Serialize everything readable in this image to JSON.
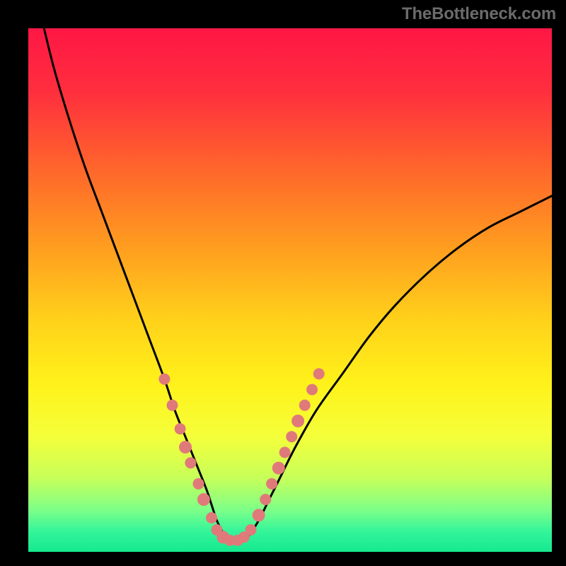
{
  "watermark": "TheBottleneck.com",
  "colors": {
    "frame": "#000000",
    "gradient_stops": [
      {
        "offset": 0.0,
        "color": "#ff1745"
      },
      {
        "offset": 0.12,
        "color": "#ff2e3e"
      },
      {
        "offset": 0.28,
        "color": "#ff6a2a"
      },
      {
        "offset": 0.42,
        "color": "#ff9e1f"
      },
      {
        "offset": 0.56,
        "color": "#ffd21a"
      },
      {
        "offset": 0.68,
        "color": "#fff21a"
      },
      {
        "offset": 0.78,
        "color": "#f4ff3a"
      },
      {
        "offset": 0.86,
        "color": "#c6ff5a"
      },
      {
        "offset": 0.92,
        "color": "#7dff88"
      },
      {
        "offset": 0.96,
        "color": "#35f59a"
      },
      {
        "offset": 1.0,
        "color": "#15e98f"
      }
    ],
    "curve": "#000000",
    "marker_fill": "#e07a7a",
    "marker_stroke": "#c96060"
  },
  "chart_data": {
    "type": "line",
    "title": "",
    "xlabel": "",
    "ylabel": "",
    "xlim": [
      0,
      100
    ],
    "ylim": [
      0,
      100
    ],
    "grid": false,
    "legend": false,
    "series": [
      {
        "name": "bottleneck-curve",
        "x": [
          3,
          5,
          8,
          11,
          14,
          17,
          20,
          23,
          26,
          28,
          30,
          32,
          34,
          35,
          36,
          37,
          38,
          39,
          40,
          42,
          44,
          46,
          48,
          51,
          55,
          60,
          65,
          70,
          76,
          82,
          88,
          94,
          100
        ],
        "y": [
          100,
          92,
          82,
          73,
          65,
          57,
          49,
          41,
          33,
          27,
          22,
          17,
          12,
          9,
          6,
          4,
          2.5,
          2,
          2,
          3,
          6,
          10,
          14,
          20,
          27,
          34,
          41,
          47,
          53,
          58,
          62,
          65,
          68
        ]
      }
    ],
    "markers": [
      {
        "x": 26,
        "y": 33,
        "r": 8
      },
      {
        "x": 27.5,
        "y": 28,
        "r": 8
      },
      {
        "x": 29,
        "y": 23.5,
        "r": 8
      },
      {
        "x": 30,
        "y": 20,
        "r": 9
      },
      {
        "x": 31,
        "y": 17,
        "r": 8
      },
      {
        "x": 32.5,
        "y": 13,
        "r": 8
      },
      {
        "x": 33.5,
        "y": 10,
        "r": 9
      },
      {
        "x": 35,
        "y": 6.5,
        "r": 8
      },
      {
        "x": 36,
        "y": 4.2,
        "r": 8
      },
      {
        "x": 37.2,
        "y": 2.8,
        "r": 9
      },
      {
        "x": 38.5,
        "y": 2.2,
        "r": 8
      },
      {
        "x": 40,
        "y": 2.2,
        "r": 8
      },
      {
        "x": 41.2,
        "y": 2.8,
        "r": 8
      },
      {
        "x": 42.5,
        "y": 4.2,
        "r": 8
      },
      {
        "x": 44,
        "y": 7,
        "r": 9
      },
      {
        "x": 45.3,
        "y": 10,
        "r": 8
      },
      {
        "x": 46.5,
        "y": 13,
        "r": 8
      },
      {
        "x": 47.8,
        "y": 16,
        "r": 9
      },
      {
        "x": 49,
        "y": 19,
        "r": 8
      },
      {
        "x": 50.3,
        "y": 22,
        "r": 8
      },
      {
        "x": 51.5,
        "y": 25,
        "r": 9
      },
      {
        "x": 52.8,
        "y": 28,
        "r": 8
      },
      {
        "x": 54.2,
        "y": 31,
        "r": 8
      },
      {
        "x": 55.5,
        "y": 34,
        "r": 8
      }
    ]
  }
}
